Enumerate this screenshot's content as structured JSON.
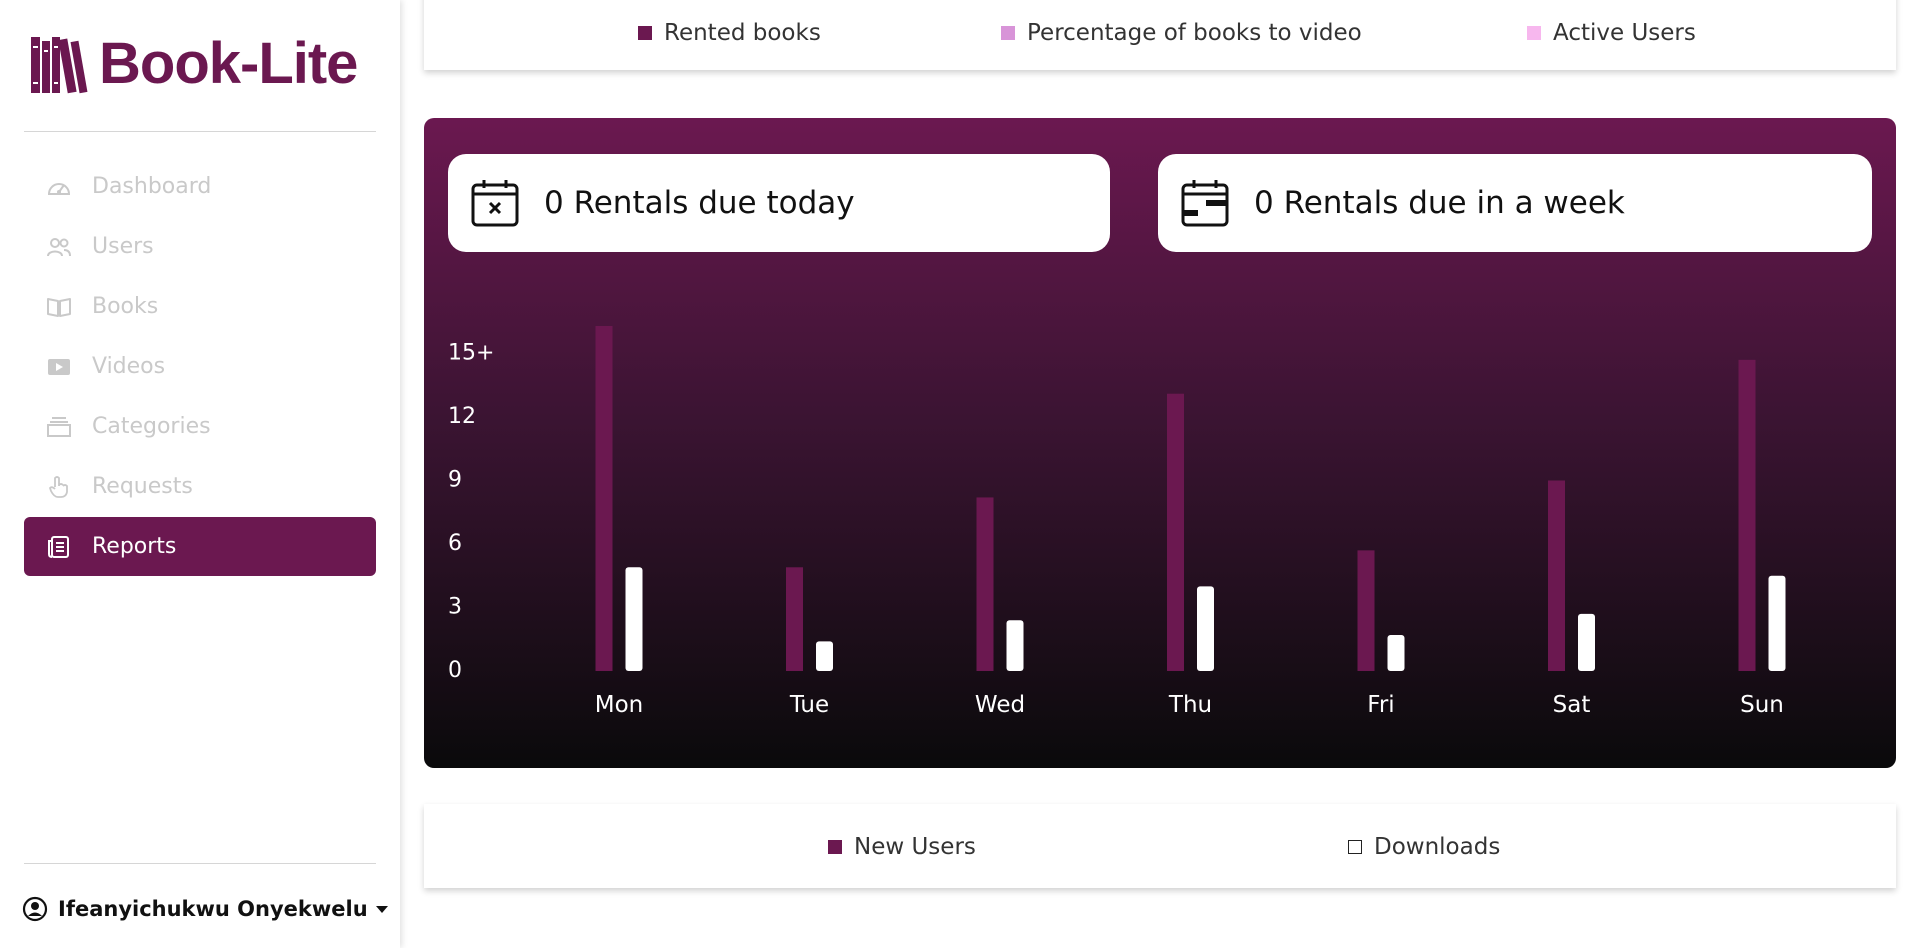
{
  "brand": {
    "name": "Book-Lite"
  },
  "sidebar": {
    "items": [
      {
        "label": "Dashboard",
        "icon": "gauge-icon",
        "active": false
      },
      {
        "label": "Users",
        "icon": "users-icon",
        "active": false
      },
      {
        "label": "Books",
        "icon": "book-open-icon",
        "active": false
      },
      {
        "label": "Videos",
        "icon": "video-icon",
        "active": false
      },
      {
        "label": "Categories",
        "icon": "stack-icon",
        "active": false
      },
      {
        "label": "Requests",
        "icon": "hand-pointer-icon",
        "active": false
      },
      {
        "label": "Reports",
        "icon": "report-icon",
        "active": true
      }
    ],
    "user_name": "Ifeanyichukwu Onyekwelu"
  },
  "top_legend": [
    {
      "label": "Rented books",
      "color": "#6b1850"
    },
    {
      "label": "Percentage of books to video",
      "color": "#d894d8"
    },
    {
      "label": "Active Users",
      "color": "#f7b7ee"
    }
  ],
  "cards": {
    "today": "0 Rentals due today",
    "week": "0 Rentals due in a week"
  },
  "bottom_legend": [
    {
      "label": "New Users",
      "color": "#6b1850"
    },
    {
      "label": "Downloads",
      "color": "#ffffff"
    }
  ],
  "colors": {
    "accent": "#6b1850",
    "bar_secondary": "#ffffff"
  },
  "chart_data": {
    "type": "bar",
    "categories": [
      "Mon",
      "Tue",
      "Wed",
      "Thu",
      "Fri",
      "Sat",
      "Sun"
    ],
    "series": [
      {
        "name": "New Users",
        "values": [
          16.3,
          4.9,
          8.2,
          13.1,
          5.7,
          9.0,
          14.7
        ],
        "color": "#6b1850"
      },
      {
        "name": "Downloads",
        "values": [
          4.9,
          1.4,
          2.4,
          4.0,
          1.7,
          2.7,
          4.5
        ],
        "color": "#ffffff"
      }
    ],
    "y_ticks": [
      "0",
      "3",
      "6",
      "9",
      "12",
      "15+"
    ],
    "ylim": [
      0,
      15
    ],
    "grid": false,
    "legend": "bottom",
    "xlabel": "",
    "ylabel": ""
  }
}
